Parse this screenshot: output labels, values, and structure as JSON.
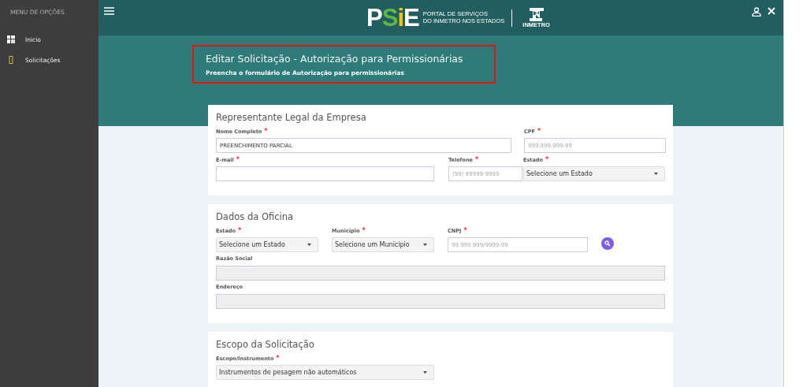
{
  "sidebar": {
    "heading": "MENU DE OPÇÕES",
    "items": [
      {
        "label": "Inicio",
        "kind": "dashboard"
      },
      {
        "label": "Solicitações",
        "kind": "requests"
      }
    ]
  },
  "header": {
    "logo_letters": [
      {
        "text": "P",
        "color": "#ffffff"
      },
      {
        "text": "S",
        "color": "#5bb947"
      },
      {
        "text": "i",
        "color": "#f4c20d"
      },
      {
        "text": "E",
        "color": "#ffffff"
      }
    ],
    "logo_caption": [
      "PORTAL DE SERVIÇOS",
      "DO INMETRO NOS ESTADOS"
    ],
    "partner": "INMETRO"
  },
  "banner": {
    "title": "Editar Solicitação - Autorização para Permissionárias",
    "subtitle": "Preencha o formulário de Autorização para permissionárias"
  },
  "cards": [
    {
      "title": "Representante Legal da Empresa",
      "rows": [
        {
          "fields": [
            {
              "label": "Nome Completo",
              "required_mark": "*",
              "kind": "input",
              "value": "PREENCHIMENTO PARCIAL",
              "disabled": false
            },
            {
              "label": "CPF",
              "required_mark": "*",
              "kind": "input",
              "placeholder": "999.999.999-99",
              "disabled": false
            }
          ]
        },
        {
          "fields": [
            {
              "label": "E-mail",
              "required_mark": "*",
              "kind": "input",
              "disabled": false
            },
            {
              "label": "Telefone",
              "required_mark": "*",
              "kind": "input",
              "placeholder": "(99) 99999-9999",
              "disabled": false
            },
            {
              "label": "Estado",
              "required_mark": "*",
              "kind": "select",
              "value": "Selecione um Estado"
            }
          ]
        }
      ]
    },
    {
      "title": "Dados da Oficina",
      "rows": [
        {
          "fields": [
            {
              "label": "Estado",
              "required_mark": "*",
              "kind": "select",
              "value": "Selecione um Estado"
            },
            {
              "label": "Município",
              "required_mark": "*",
              "kind": "select",
              "value": "Selecione um Município"
            },
            {
              "label": "CNPJ",
              "required_mark": "*",
              "kind": "input",
              "placeholder": "99.999.999/9999-99",
              "disabled": false
            },
            {
              "kind": "search-button"
            }
          ]
        },
        {
          "fields": [
            {
              "label": "Razão Social",
              "kind": "input",
              "disabled": true
            }
          ]
        },
        {
          "fields": [
            {
              "label": "Endereço",
              "kind": "input",
              "disabled": true
            }
          ]
        }
      ]
    },
    {
      "title": "Escopo da Solicitação",
      "rows": [
        {
          "fields": [
            {
              "label": "Escopo/Instrumento",
              "required_mark": "*",
              "kind": "select",
              "value": "Instrumentos de pesagem não automáticos"
            }
          ]
        }
      ]
    }
  ]
}
